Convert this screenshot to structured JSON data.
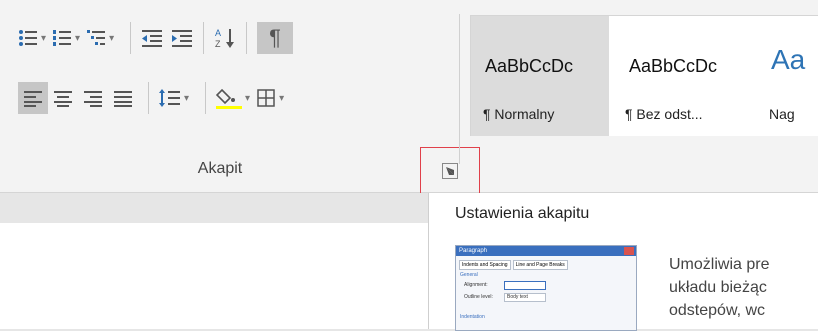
{
  "ribbon": {
    "group_label": "Akapit",
    "paragraph_launcher_icon": "dialog-launcher-icon",
    "row1": [
      {
        "name": "bullets-button",
        "icon": "bullets-icon",
        "dropdown": "▾"
      },
      {
        "name": "numbering-button",
        "icon": "numbering-icon",
        "dropdown": "▾"
      },
      {
        "name": "multilevel-list-button",
        "icon": "multilevel-list-icon",
        "dropdown": "▾"
      },
      {
        "name": "decrease-indent-button",
        "icon": "decrease-indent-icon"
      },
      {
        "name": "increase-indent-button",
        "icon": "increase-indent-icon"
      },
      {
        "name": "sort-button",
        "icon": "sort-az-icon"
      },
      {
        "name": "show-hide-marks-button",
        "icon": "pilcrow-icon",
        "glyph": "¶"
      }
    ],
    "row2": [
      {
        "name": "align-left-button",
        "icon": "align-left-icon",
        "selected": true
      },
      {
        "name": "center-button",
        "icon": "align-center-icon"
      },
      {
        "name": "align-right-button",
        "icon": "align-right-icon"
      },
      {
        "name": "justify-button",
        "icon": "justify-icon"
      },
      {
        "name": "line-spacing-button",
        "icon": "line-spacing-icon",
        "dropdown": "▾"
      },
      {
        "name": "shading-button",
        "icon": "paint-bucket-icon",
        "dropdown": "▾",
        "accent": "#ffff00"
      },
      {
        "name": "borders-button",
        "icon": "borders-icon",
        "dropdown": "▾"
      }
    ]
  },
  "styles": [
    {
      "preview": "AaBbCcDc",
      "name": "¶ Normalny",
      "active": true
    },
    {
      "preview": "AaBbCcDc",
      "name": "¶ Bez odst..."
    },
    {
      "preview": "Aa",
      "name": "Nag"
    }
  ],
  "tooltip": {
    "title": "Ustawienia akapitu",
    "text": "Umożliwia pre\nukładu bieżąc\nodstepów, wc",
    "thumb": {
      "title": "Paragraph",
      "tab1": "Indents and Spacing",
      "tab2": "Line and Page Breaks",
      "general": "General",
      "alignment": "Alignment:",
      "outline": "Outline level:",
      "outline_val": "Body text",
      "indentation": "Indentation"
    }
  },
  "colors": {
    "accent_highlight": "#ffff00",
    "launcher_border": "#e0404a"
  }
}
